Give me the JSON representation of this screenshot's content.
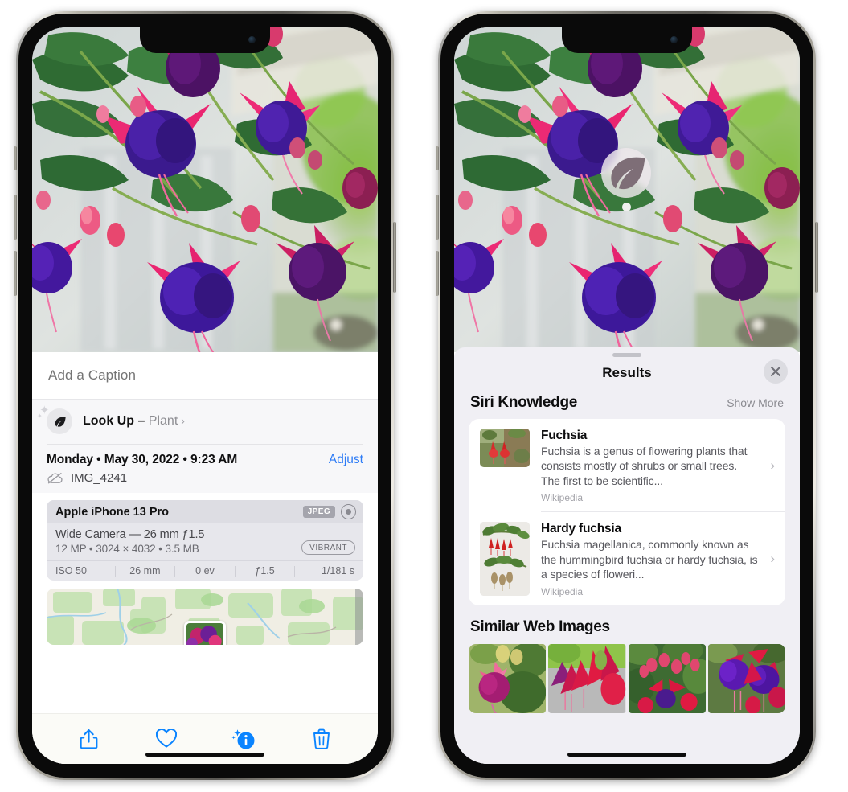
{
  "left_phone": {
    "name": "iPhone showing Photos app info panel",
    "caption_field": {
      "placeholder": "Add a Caption",
      "value": ""
    },
    "lookup": {
      "label_bold": "Look Up",
      "dash": " – ",
      "subject": "Plant",
      "chevron": "›",
      "icon": "leaf-icon",
      "sparkle": "✦",
      "sparkle_small": "✦"
    },
    "date_row": {
      "date": "Monday • May 30, 2022 • 9:23 AM",
      "adjust_label": "Adjust"
    },
    "file_row": {
      "icon": "cloud-slash-icon",
      "filename": "IMG_4241"
    },
    "camera_card": {
      "model": "Apple iPhone 13 Pro",
      "format_badge": "JPEG",
      "raw_icon": "raw-capture-icon",
      "lens_line": "Wide Camera — 26 mm ƒ1.5",
      "spec_line": "12 MP • 3024 × 4032 • 3.5 MB",
      "style_badge": "VIBRANT",
      "exif": [
        "ISO 50",
        "26 mm",
        "0 ev",
        "ƒ1.5",
        "1/181 s"
      ]
    },
    "map": {
      "name": "location-map-thumbnail"
    },
    "toolbar": [
      {
        "name": "share-button",
        "icon": "share-icon"
      },
      {
        "name": "favorite-button",
        "icon": "heart-icon"
      },
      {
        "name": "info-button",
        "icon": "info-sparkle-icon",
        "active": true
      },
      {
        "name": "delete-button",
        "icon": "trash-icon"
      }
    ]
  },
  "right_phone": {
    "name": "iPhone showing Visual Look Up results",
    "detect_badge": {
      "icon": "leaf-icon",
      "label": "plant-detected-badge"
    },
    "sheet": {
      "grabber": "drag-handle",
      "title": "Results",
      "close_icon": "close-icon"
    },
    "siri_knowledge": {
      "heading": "Siri Knowledge",
      "show_more": "Show More",
      "items": [
        {
          "title": "Fuchsia",
          "description": "Fuchsia is a genus of flowering plants that consists mostly of shrubs or small trees. The first to be scientific...",
          "source": "Wikipedia",
          "thumb": "fuchsia-thumbnail",
          "chevron": "›"
        },
        {
          "title": "Hardy fuchsia",
          "description": "Fuchsia magellanica, commonly known as the hummingbird fuchsia or hardy fuchsia, is a species of floweri...",
          "source": "Wikipedia",
          "thumb": "hardy-fuchsia-thumbnail",
          "chevron": "›"
        }
      ]
    },
    "similar_web_images": {
      "heading": "Similar Web Images",
      "tiles": [
        "web-image-1-fuchsia-pink",
        "web-image-2-fuchsia-red",
        "web-image-3-fuchsia-bush",
        "web-image-4-fuchsia-purple"
      ]
    }
  },
  "colors": {
    "accent_blue": "#2e7cf6",
    "sheet_gray": "#f0eff4",
    "card_white": "#ffffff",
    "text_primary": "#0d0d0e",
    "text_secondary": "#58585e",
    "text_tertiary": "#a3a3a9"
  }
}
